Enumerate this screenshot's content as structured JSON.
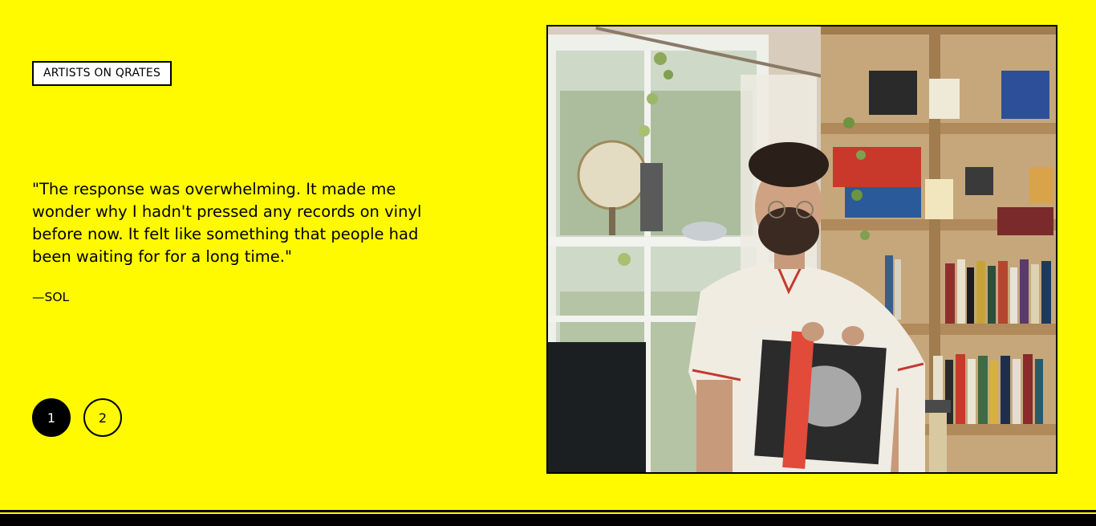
{
  "tag": {
    "label": "ARTISTS ON QRATES"
  },
  "testimonial": {
    "quote": "\"The response was overwhelming. It made me wonder why I hadn't pressed any records on vinyl before now. It felt like something that people had been waiting for for a long time.\"",
    "attribution": "—SOL"
  },
  "pager": {
    "items": [
      {
        "label": "1",
        "active": true
      },
      {
        "label": "2",
        "active": false
      }
    ]
  },
  "colors": {
    "background": "#FFFA00",
    "text": "#000000",
    "active_dot": "#000000"
  }
}
